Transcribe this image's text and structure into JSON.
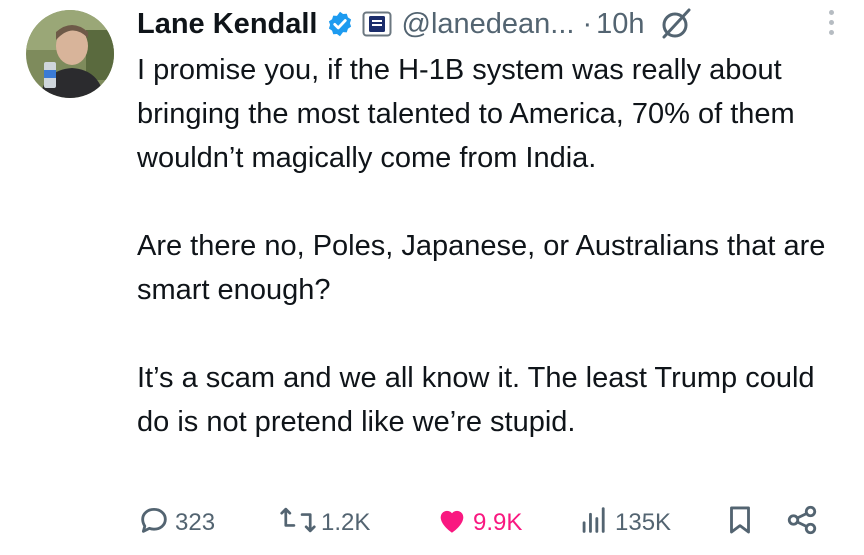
{
  "author": {
    "name": "Lane Kendall",
    "handle": "@lanedean...",
    "separator": "·",
    "timestamp": "10h"
  },
  "icons": {
    "verified": "verified-badge-icon",
    "affiliation": "affiliation-badge-icon",
    "grok": "grok-icon",
    "more": "more-options-icon",
    "reply": "reply-icon",
    "repost": "repost-icon",
    "like": "heart-icon",
    "views": "views-icon",
    "bookmark": "bookmark-icon",
    "share": "share-icon"
  },
  "tweet": {
    "paragraphs": [
      "I promise you, if the H-1B system was really about bringing the most talented to America, 70% of them wouldn’t magically come from India.",
      "Are there no, Poles, Japanese, or Australians that are smart enough?",
      "It’s a scam and we all know it. The least Trump could do is not pretend like we’re stupid."
    ]
  },
  "stats": {
    "replies": "323",
    "reposts": "1.2K",
    "likes": "9.9K",
    "views": "135K"
  },
  "colors": {
    "text": "#0f1419",
    "secondary": "#536471",
    "verified": "#1d9bf0",
    "like": "#f91880"
  }
}
